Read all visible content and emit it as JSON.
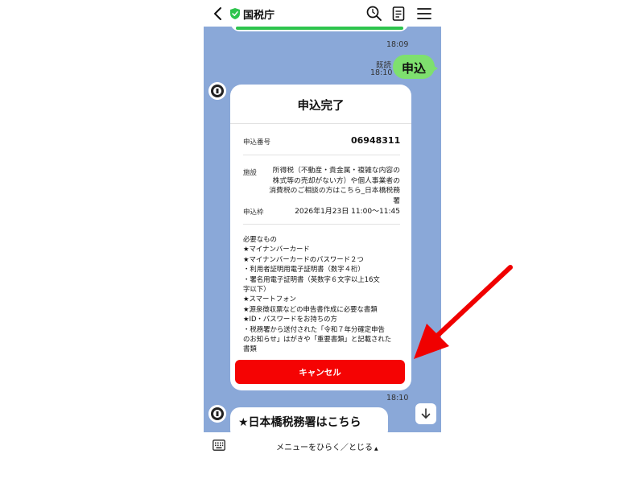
{
  "header": {
    "title": "国税庁",
    "icons": [
      "back-icon",
      "verified-shield-icon",
      "search-history-icon",
      "notes-icon",
      "menu-icon"
    ]
  },
  "chat": {
    "previous_time": "18:09",
    "user_message": {
      "read_label": "既読",
      "time": "18:10",
      "text": "申込"
    },
    "card": {
      "title": "申込完了",
      "application_number_label": "申込番号",
      "application_number": "06948311",
      "facility_label": "施設",
      "facility_lines": [
        "所得税（不動産・貴金属・複雑な内容の",
        "株式等の売却がない方）や個人事業者の",
        "消費税のご相談の方はこちら_日本橋税務",
        "署"
      ],
      "slot_label": "申込枠",
      "slot_value": "2026年1月23日 11:00～11:45",
      "notes_lines": [
        "必要なもの",
        "★マイナンバーカード",
        "★マイナンバーカードのパスワード２つ",
        "・利用者証明用電子証明書（数字４桁）",
        "・署名用電子証明書（英数字６文字以上16文",
        "字以下）",
        "★スマートフォン",
        "★源泉徴収票などの申告書作成に必要な書類",
        "★ID・パスワードをお持ちの方",
        "・税務署から送付された「令和７年分確定申告",
        "のお知らせ」はがきや「重要書類」と記載された",
        "書類"
      ],
      "cancel_label": "キャンセル",
      "time": "18:10"
    },
    "next_message_text": "★日本橋税務署はこちら"
  },
  "footer": {
    "menu_toggle_label": "メニューをひらく／とじる",
    "caret": "▲"
  },
  "colors": {
    "chat_background": "#8aa8d8",
    "user_bubble": "#7ee06e",
    "cancel_button": "#f50303",
    "annotation_arrow": "#f00000",
    "verified_badge": "#2ec44d"
  }
}
